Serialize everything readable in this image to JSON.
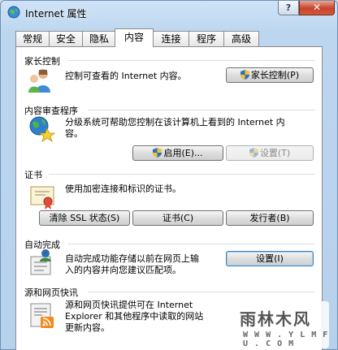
{
  "window": {
    "title": "Internet 属性"
  },
  "titlebar": {
    "help_label": "?",
    "close_label": "✕"
  },
  "tabs": [
    {
      "label": "常规"
    },
    {
      "label": "安全"
    },
    {
      "label": "隐私"
    },
    {
      "label": "内容"
    },
    {
      "label": "连接"
    },
    {
      "label": "程序"
    },
    {
      "label": "高级"
    }
  ],
  "active_tab": "内容",
  "sections": {
    "parental": {
      "title": "家长控制",
      "description": "控制可查看的 Internet 内容。",
      "button": "家长控制(P)",
      "icon": "family-icon"
    },
    "advisor": {
      "title": "内容审查程序",
      "description_line1": "分级系统可帮助您控制在该计算机上看到的 Internet 内",
      "description_line2": "容。",
      "enable_button": "启用(E)...",
      "settings_button": "设置(T)",
      "icon": "globe-star-icon"
    },
    "certificates": {
      "title": "证书",
      "description": "使用加密连接和标识的证书。",
      "clear_ssl_button": "清除 SSL 状态(S)",
      "certificates_button": "证书(C)",
      "publishers_button": "发行者(B)",
      "icon": "certificate-icon"
    },
    "autocomplete": {
      "title": "自动完成",
      "description_line1": "自动完成功能存储以前在网页上输",
      "description_line2": "入的内容并向您建议匹配项。",
      "settings_button": "设置(I)",
      "icon": "form-user-icon"
    },
    "feeds": {
      "title": "源和网页快讯",
      "description_line1": "源和网页快讯提供可在 Internet",
      "description_line2": "Explorer 和其他程序中读取的网站",
      "description_line3": "更新内容。",
      "icon": "feed-icon"
    }
  },
  "watermark": {
    "main": "雨林木风",
    "sub": "W W W . Y L M F U . C O M"
  },
  "colors": {
    "accent_border": "#3c7fb1",
    "title_gradient_top": "#cfe3f7",
    "close_red": "#c7432a"
  }
}
